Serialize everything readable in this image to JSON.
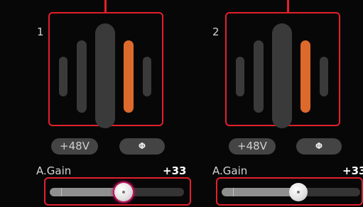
{
  "channels": [
    {
      "number": "1",
      "phantom_label": "+48V",
      "phase_label": "Φ",
      "gain_label": "A.Gain",
      "gain_value": "+33",
      "meter_level_fraction": 0.6,
      "gain_position_fraction": 0.52
    },
    {
      "number": "2",
      "phantom_label": "+48V",
      "phase_label": "Φ",
      "gain_label": "A.Gain",
      "gain_value": "+33",
      "meter_level_fraction": 0.6,
      "gain_position_fraction": 0.52
    }
  ],
  "colors": {
    "highlight": "#e3202c",
    "meter_level": "#dd6a2c",
    "knob_glow": "#c0175e"
  },
  "icons": {
    "phase_button": "phase-invert-icon"
  }
}
